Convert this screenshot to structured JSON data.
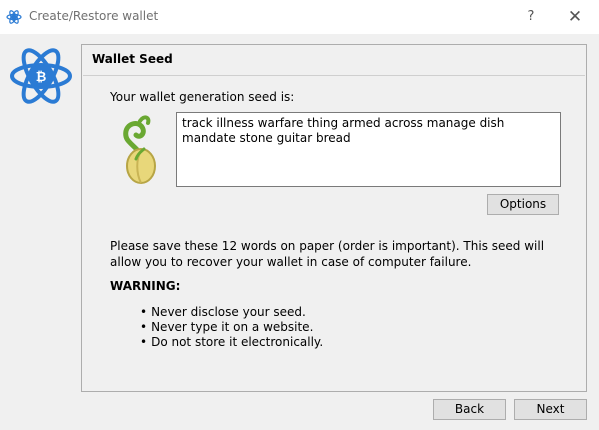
{
  "window": {
    "title": "Create/Restore wallet",
    "help_label": "?",
    "close_label": "✕"
  },
  "panel": {
    "title": "Wallet Seed",
    "seed_label": "Your wallet generation seed is:",
    "seed_text": "track illness warfare thing armed across manage dish mandate stone guitar bread",
    "options_label": "Options",
    "save_notice": "Please save these 12 words on paper (order is important). This seed will allow you to recover your wallet in case of computer failure.",
    "warning_title": "WARNING:",
    "warnings": [
      "Never disclose your seed.",
      "Never type it on a website.",
      "Do not store it electronically."
    ]
  },
  "footer": {
    "back_label": "Back",
    "next_label": "Next"
  },
  "icons": {
    "app": "electrum-icon",
    "logo": "electrum-logo",
    "seed": "seed-sprout-icon"
  },
  "colors": {
    "logo_blue": "#2b7bd4",
    "window_bg": "#f0f0f0",
    "button_bg": "#e1e1e1"
  }
}
